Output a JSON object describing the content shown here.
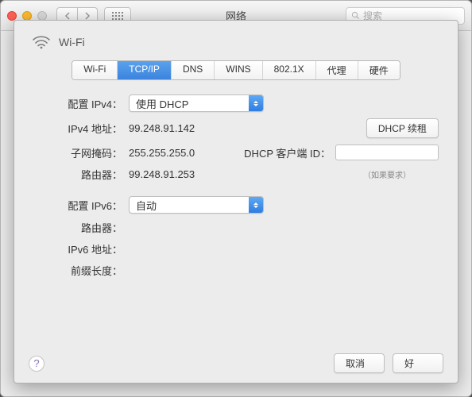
{
  "titlebar": {
    "title": "网络",
    "search_placeholder": "搜索"
  },
  "panel_header": {
    "name": "Wi-Fi"
  },
  "tabs": [
    {
      "label": "Wi-Fi",
      "active": false
    },
    {
      "label": "TCP/IP",
      "active": true
    },
    {
      "label": "DNS",
      "active": false
    },
    {
      "label": "WINS",
      "active": false
    },
    {
      "label": "802.1X",
      "active": false
    },
    {
      "label": "代理",
      "active": false
    },
    {
      "label": "硬件",
      "active": false
    }
  ],
  "ipv4": {
    "config_label": "配置 IPv4：",
    "config_value": "使用 DHCP",
    "address_label": "IPv4 地址：",
    "address_value": "99.248.91.142",
    "subnet_label": "子网掩码：",
    "subnet_value": "255.255.255.0",
    "router_label": "路由器：",
    "router_value": "99.248.91.253",
    "dhcp_renew": "DHCP 续租",
    "dhcp_client_id_label": "DHCP 客户端 ID：",
    "dhcp_client_id_value": "",
    "dhcp_hint": "（如果要求）"
  },
  "ipv6": {
    "config_label": "配置 IPv6：",
    "config_value": "自动",
    "router_label": "路由器：",
    "router_value": "",
    "address_label": "IPv6 地址：",
    "address_value": "",
    "prefix_label": "前缀长度：",
    "prefix_value": ""
  },
  "footer": {
    "cancel": "取消",
    "ok": "好"
  }
}
